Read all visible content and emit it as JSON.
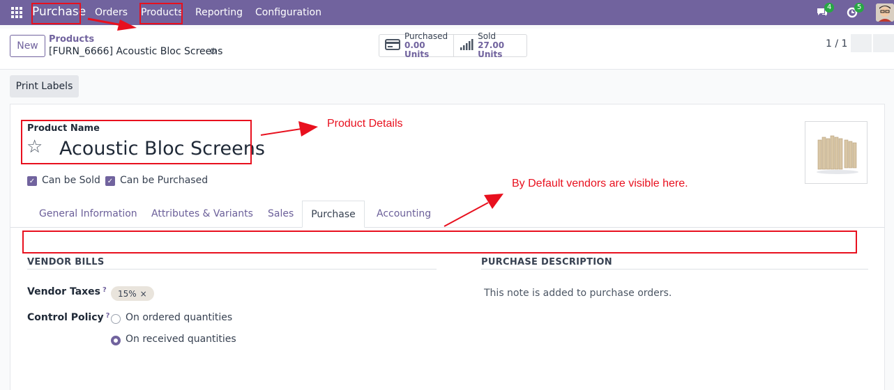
{
  "navbar": {
    "brand": "Purchase",
    "menu": [
      "Orders",
      "Products",
      "Reporting",
      "Configuration"
    ],
    "chat_count": "4",
    "activity_count": "5",
    "bg_color": "#71639e"
  },
  "control_panel": {
    "new_label": "New",
    "breadcrumb_parent": "Products",
    "breadcrumb_current": "[FURN_6666] Acoustic Bloc Screens",
    "smart_buttons": [
      {
        "label": "Purchased",
        "value": "0.00 Units",
        "icon": "credit-card-icon"
      },
      {
        "label": "Sold",
        "value": "27.00 Units",
        "icon": "bar-chart-icon"
      }
    ],
    "pager": "1 / 1"
  },
  "action_bar": {
    "print_label": "Print Labels"
  },
  "form": {
    "product_name_label": "Product Name",
    "product_name": "Acoustic Bloc Screens",
    "checkboxes": [
      {
        "label": "Can be Sold",
        "checked": true
      },
      {
        "label": "Can be Purchased",
        "checked": true
      }
    ],
    "tabs": [
      "General Information",
      "Attributes & Variants",
      "Sales",
      "Purchase",
      "Accounting"
    ],
    "active_tab": "Purchase",
    "vendor_bills_title": "VENDOR BILLS",
    "vendor_taxes_label": "Vendor Taxes",
    "vendor_taxes_help": "?",
    "vendor_tax_tag": "15%",
    "tag_remove": "×",
    "control_policy_label": "Control Policy",
    "control_policy_help": "?",
    "control_policy_options": [
      {
        "label": "On ordered quantities",
        "selected": false
      },
      {
        "label": "On received quantities",
        "selected": true
      }
    ],
    "purchase_description_title": "PURCHASE DESCRIPTION",
    "purchase_description_placeholder": "This note is added to purchase orders."
  },
  "annotations": {
    "product_details": "Product Details",
    "vendors_note": "By Default vendors are visible here.",
    "color": "#e8101e"
  }
}
